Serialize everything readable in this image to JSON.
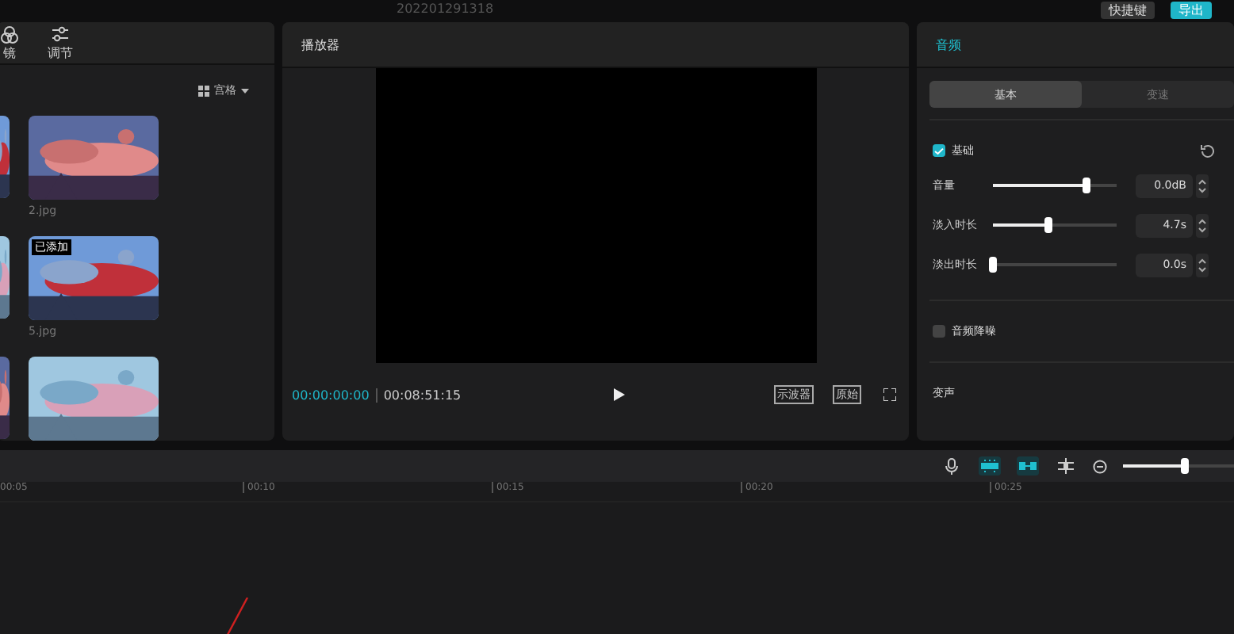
{
  "top_bar": {
    "project_name": "202201291318",
    "shortcut_button": "快捷键",
    "export_button": "导出"
  },
  "media_panel": {
    "tools": [
      {
        "label": "镜",
        "kind": "effects"
      },
      {
        "label": "调节",
        "kind": "adjust"
      }
    ],
    "view_menu": "宫格",
    "items": [
      {
        "name": "2.jpg",
        "kind": "picture"
      },
      {
        "name": "5.jpg",
        "kind": "picture",
        "added_badge": "已添加"
      },
      {
        "kind": "picture"
      }
    ]
  },
  "player": {
    "title": "播放器",
    "current_time": "00:00:00:00",
    "total_time": "00:08:51:15",
    "buttons": [
      "示波器",
      "原始"
    ]
  },
  "inspector": {
    "title": "音频",
    "tabs": [
      {
        "label": "基本",
        "selected": true
      },
      {
        "label": "变速",
        "selected": false
      }
    ],
    "basic": {
      "label": "基础",
      "checked": true
    },
    "sliders": [
      {
        "label": "音量",
        "level": 0.75,
        "value": "0.0dB"
      },
      {
        "label": "淡入时长",
        "level": 0.45,
        "value": "4.7s"
      },
      {
        "label": "淡出时长",
        "level": 0.0,
        "value": "0.0s"
      }
    ],
    "denoise": {
      "label": "音频降噪",
      "checked": false
    },
    "voice_changer": "变声"
  },
  "timeline": {
    "tools": [
      {
        "kind": "mic",
        "on": false
      },
      {
        "kind": "magnet",
        "on": true
      },
      {
        "kind": "link",
        "on": true
      },
      {
        "kind": "split",
        "on": false
      }
    ],
    "zoom": {
      "level": 0.55
    },
    "ticks": [
      "00:05",
      "00:10",
      "00:15",
      "00:20",
      "00:25"
    ]
  }
}
